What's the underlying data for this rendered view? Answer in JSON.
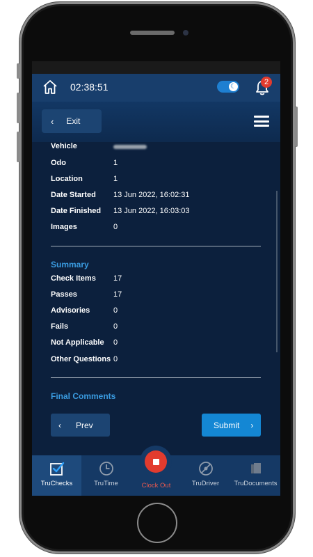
{
  "topbar": {
    "time": "02:38:51",
    "notification_count": "2"
  },
  "subheader": {
    "exit_label": "Exit"
  },
  "details": [
    {
      "label": "Vehicle",
      "value": ""
    },
    {
      "label": "Odo",
      "value": "1"
    },
    {
      "label": "Location",
      "value": "1"
    },
    {
      "label": "Date Started",
      "value": "13 Jun 2022, 16:02:31"
    },
    {
      "label": "Date Finished",
      "value": "13 Jun 2022, 16:03:03"
    },
    {
      "label": "Images",
      "value": "0"
    }
  ],
  "summary": {
    "title": "Summary",
    "rows": [
      {
        "label": "Check Items",
        "value": "17"
      },
      {
        "label": "Passes",
        "value": "17"
      },
      {
        "label": "Advisories",
        "value": "0"
      },
      {
        "label": "Fails",
        "value": "0"
      },
      {
        "label": "Not Applicable",
        "value": "0"
      },
      {
        "label": "Other Questions",
        "value": "0"
      }
    ]
  },
  "final_comments": {
    "title": "Final Comments"
  },
  "actions": {
    "prev_label": "Prev",
    "submit_label": "Submit"
  },
  "bottom_nav": {
    "items": [
      {
        "label": "TruChecks",
        "icon": "checkbox-icon"
      },
      {
        "label": "TruTime",
        "icon": "clock-icon"
      },
      {
        "label": "Clock Out",
        "icon": "stop-icon"
      },
      {
        "label": "TruDriver",
        "icon": "steering-wheel-icon"
      },
      {
        "label": "TruDocuments",
        "icon": "documents-icon"
      }
    ]
  },
  "colors": {
    "background": "#0c203d",
    "accent": "#1487d4",
    "section_title": "#3a9be0",
    "stop": "#e23b2e"
  }
}
